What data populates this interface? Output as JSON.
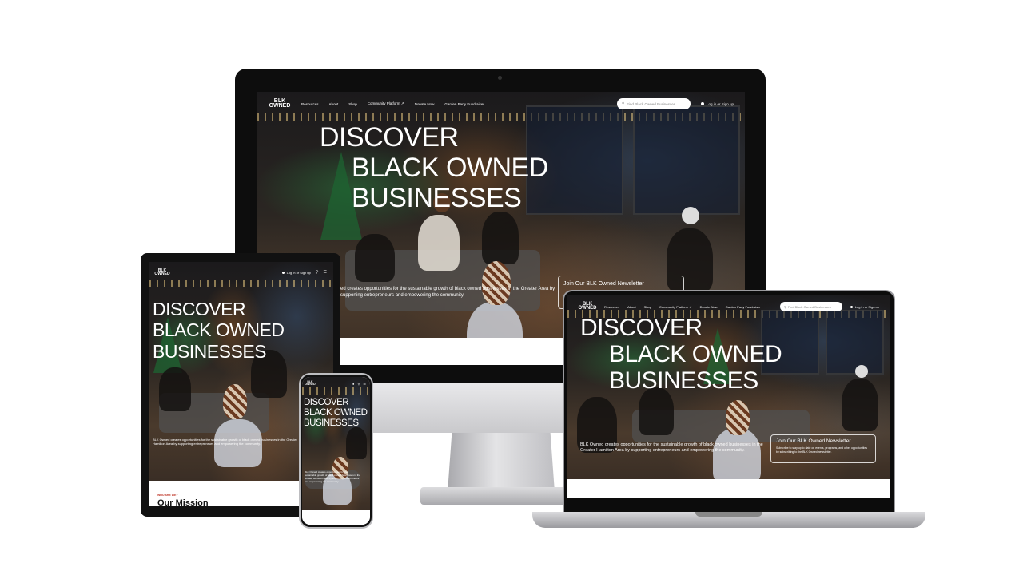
{
  "hero": {
    "line1": "DISCOVER",
    "line2": "BLACK OWNED",
    "line3": "BUSINESSES"
  },
  "brand": {
    "logo_line1": "BLK",
    "logo_line2": "OWNED",
    "logo_sub": "HAMILTON"
  },
  "nav": {
    "items": [
      "Resources",
      "About",
      "Shop",
      "Community Platform ↗",
      "Donate Now",
      "Garden Party Fundraiser"
    ],
    "search_placeholder": "Find Black Owned Businesses",
    "login": "Log in or Sign up",
    "login_short": "Log in or Sign up"
  },
  "mission": {
    "text": "BLK Owned creates opportunities for the sustainable growth of black owned businesses in the Greater Hamilton Area by supporting entrepreneurs and empowering the community.",
    "imac_text": "ed creates opportunities for the sustainable growth of black owned businesses in the Greater Area by supporting entrepreneurs and empowering the community."
  },
  "newsletter": {
    "title": "Join Our BLK Owned Newsletter",
    "body": "Subscribe to stay up to date on events, programs, and other opportunities by subscribing to the BLK Owned newsletter."
  },
  "tablet_section": {
    "eyebrow": "WHO ARE WE?",
    "heading": "Our Mission"
  },
  "colors": {
    "accent": "#c0392b",
    "text_light": "#ffffff",
    "device_dark": "#0d0d0d",
    "silver": "#c9c9cc"
  }
}
